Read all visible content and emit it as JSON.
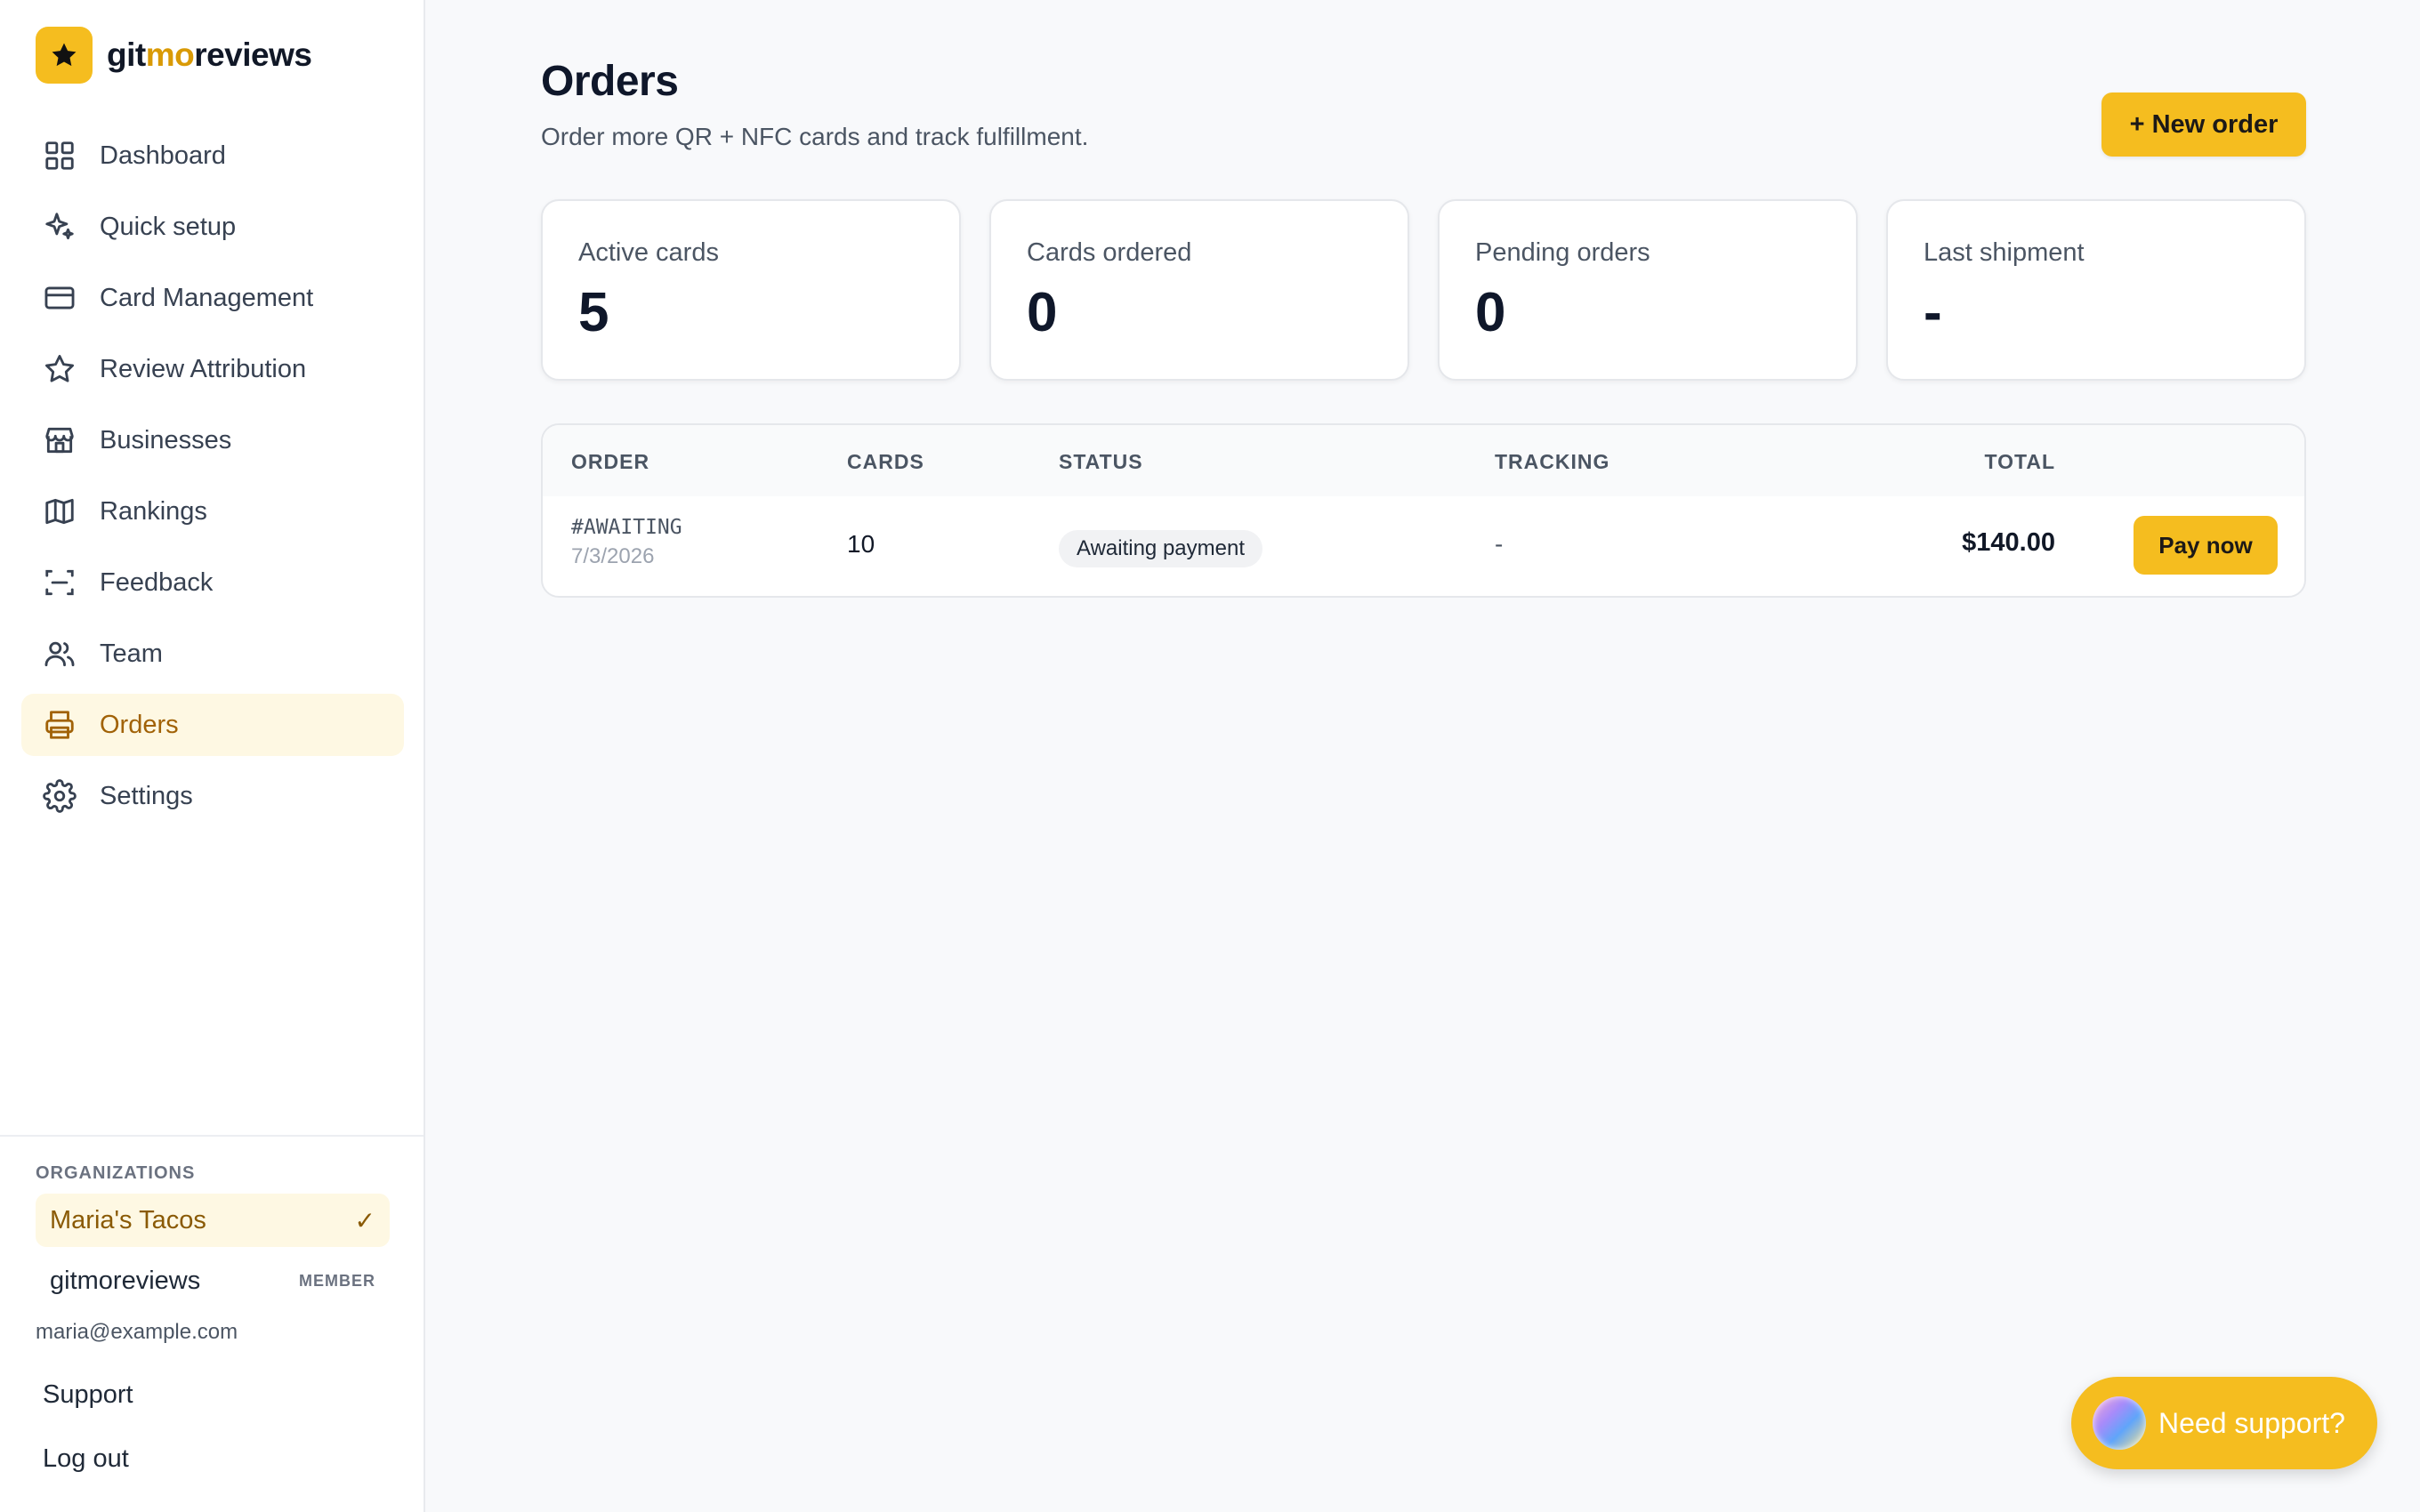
{
  "brand": {
    "prefix": "git",
    "accent": "mo",
    "suffix": "reviews",
    "accent_color": "#f5bd1f"
  },
  "nav": [
    {
      "id": "dashboard",
      "label": "Dashboard",
      "icon": "grid-icon",
      "active": false
    },
    {
      "id": "quick-setup",
      "label": "Quick setup",
      "icon": "sparkles-icon",
      "active": false
    },
    {
      "id": "card-management",
      "label": "Card Management",
      "icon": "credit-card-icon",
      "active": false
    },
    {
      "id": "review-attribution",
      "label": "Review Attribution",
      "icon": "star-icon",
      "active": false
    },
    {
      "id": "businesses",
      "label": "Businesses",
      "icon": "store-icon",
      "active": false
    },
    {
      "id": "rankings",
      "label": "Rankings",
      "icon": "map-icon",
      "active": false
    },
    {
      "id": "feedback",
      "label": "Feedback",
      "icon": "scan-icon",
      "active": false
    },
    {
      "id": "team",
      "label": "Team",
      "icon": "users-icon",
      "active": false
    },
    {
      "id": "orders",
      "label": "Orders",
      "icon": "printer-icon",
      "active": true
    },
    {
      "id": "settings",
      "label": "Settings",
      "icon": "gear-icon",
      "active": false
    }
  ],
  "organizations": {
    "heading": "ORGANIZATIONS",
    "selected": {
      "name": "Maria's Tacos",
      "check": "✓"
    },
    "other": {
      "name": "gitmoreviews",
      "role": "MEMBER"
    }
  },
  "user": {
    "email": "maria@example.com"
  },
  "links": {
    "support": "Support",
    "logout": "Log out"
  },
  "page": {
    "title": "Orders",
    "subtitle": "Order more QR + NFC cards and track fulfillment.",
    "new_order_label": "+ New order"
  },
  "stats": [
    {
      "label": "Active cards",
      "value": "5"
    },
    {
      "label": "Cards ordered",
      "value": "0"
    },
    {
      "label": "Pending orders",
      "value": "0"
    },
    {
      "label": "Last shipment",
      "value": "-"
    }
  ],
  "table": {
    "headers": {
      "order": "ORDER",
      "cards": "CARDS",
      "status": "STATUS",
      "tracking": "TRACKING",
      "total": "TOTAL"
    },
    "rows": [
      {
        "order_id": "#AWAITING",
        "date": "7/3/2026",
        "cards": "10",
        "status": "Awaiting payment",
        "tracking": "-",
        "total": "$140.00",
        "action": "Pay now"
      }
    ]
  },
  "support_widget": {
    "label": "Need support?"
  }
}
